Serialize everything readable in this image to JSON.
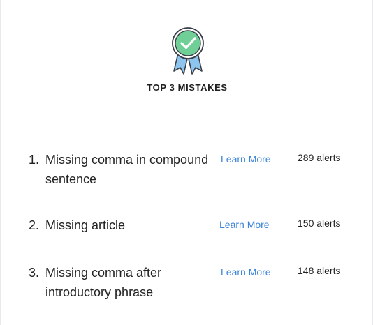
{
  "colors": {
    "badge_green": "#6fcf97",
    "ribbon_blue": "#8ec5ee",
    "link_blue": "#3b84d8"
  },
  "header": {
    "icon": "award-ribbon-checkmark-icon",
    "title": "TOP 3 MISTAKES"
  },
  "mistakes": [
    {
      "number": "1.",
      "title": "Missing comma in compound sentence",
      "link": "Learn More",
      "alerts": "289 alerts"
    },
    {
      "number": "2.",
      "title": "Missing article",
      "link": "Learn More",
      "alerts": "150 alerts"
    },
    {
      "number": "3.",
      "title": "Missing comma after introductory phrase",
      "link": "Learn More",
      "alerts": "148 alerts"
    }
  ]
}
